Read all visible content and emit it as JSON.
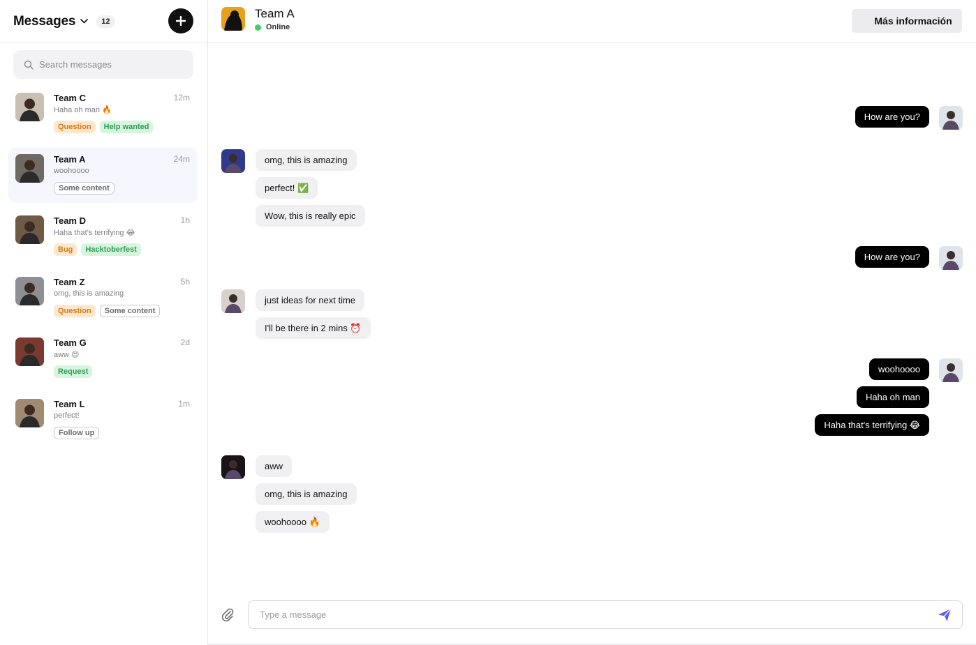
{
  "sidebar": {
    "title": "Messages",
    "unread_count": "12",
    "search_placeholder": "Search messages",
    "conversations": [
      {
        "name": "Team C",
        "time": "12m",
        "preview": "Haha oh man 🔥",
        "tags": [
          {
            "label": "Question",
            "style": "orange"
          },
          {
            "label": "Help wanted",
            "style": "green"
          }
        ],
        "avatar_color": "#c9c0b3",
        "active": false
      },
      {
        "name": "Team A",
        "time": "24m",
        "preview": "woohoooo",
        "tags": [
          {
            "label": "Some content",
            "style": "outline"
          }
        ],
        "avatar_color": "#6e6a63",
        "active": true
      },
      {
        "name": "Team D",
        "time": "1h",
        "preview": "Haha that's terrifying 😂",
        "tags": [
          {
            "label": "Bug",
            "style": "orange"
          },
          {
            "label": "Hacktoberfest",
            "style": "green"
          }
        ],
        "avatar_color": "#6f5a45",
        "active": false
      },
      {
        "name": "Team Z",
        "time": "5h",
        "preview": "omg, this is amazing",
        "tags": [
          {
            "label": "Question",
            "style": "orange"
          },
          {
            "label": "Some content",
            "style": "outline"
          }
        ],
        "avatar_color": "#8d8f93",
        "active": false
      },
      {
        "name": "Team G",
        "time": "2d",
        "preview": "aww 😍",
        "tags": [
          {
            "label": "Request",
            "style": "green"
          }
        ],
        "avatar_color": "#7a3a30",
        "active": false
      },
      {
        "name": "Team L",
        "time": "1m",
        "preview": "perfect!",
        "tags": [
          {
            "label": "Follow up",
            "style": "outline"
          }
        ],
        "avatar_color": "#a08a72",
        "active": false
      }
    ]
  },
  "header": {
    "name": "Team A",
    "status": "Online",
    "info_button": "Más información"
  },
  "messages": [
    {
      "text": "How are you?",
      "dir": "out"
    },
    {
      "text": "omg, this is amazing",
      "dir": "in"
    },
    {
      "text": "perfect! ✅",
      "dir": "in"
    },
    {
      "text": "Wow, this is really epic",
      "dir": "in"
    },
    {
      "text": "How are you?",
      "dir": "out"
    },
    {
      "text": "just ideas for next time",
      "dir": "in"
    },
    {
      "text": "I'll be there in 2 mins ⏰",
      "dir": "in"
    },
    {
      "text": "woohoooo",
      "dir": "out"
    },
    {
      "text": "Haha oh man",
      "dir": "out"
    },
    {
      "text": "Haha that's terrifying 😂",
      "dir": "out"
    },
    {
      "text": "aww",
      "dir": "in"
    },
    {
      "text": "omg, this is amazing",
      "dir": "in"
    },
    {
      "text": "woohoooo 🔥",
      "dir": "in"
    }
  ],
  "composer": {
    "placeholder": "Type a message"
  },
  "colors": {
    "accent": "#5b5bf0",
    "online": "#3ccf6c",
    "active_row": "#f5f6fe",
    "tag_orange_bg": "#fde8cf",
    "tag_green_bg": "#d6f5df"
  }
}
